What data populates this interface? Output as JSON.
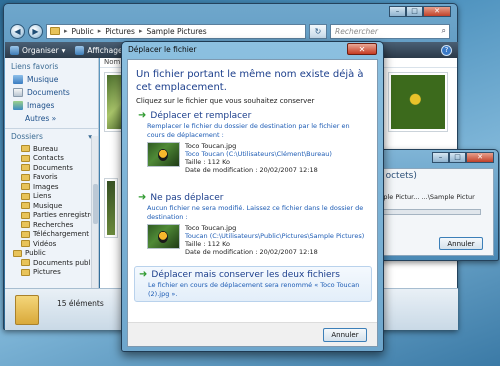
{
  "explorer": {
    "address": [
      "Public",
      "Pictures",
      "Sample Pictures"
    ],
    "search_placeholder": "Rechercher",
    "toolbar": {
      "organize": "Organiser",
      "views": "Affichages"
    },
    "help": "?",
    "nav": {
      "favorites_heading": "Liens favoris",
      "favorites": [
        "Musique",
        "Documents",
        "Images"
      ],
      "more": "Autres »",
      "folders_heading": "Dossiers",
      "folders": [
        "Bureau",
        "Contacts",
        "Documents",
        "Favoris",
        "Images",
        "Liens",
        "Musique",
        "Parties enregistrée",
        "Recherches",
        "Téléchargement",
        "Vidéos",
        "Public",
        "Documents public",
        "Pictures"
      ]
    },
    "column_header": "Nom",
    "status": "15 éléments"
  },
  "progress_window": {
    "title_fragment": "0 octets)",
    "path_fragment": "mple Pictur... ...\\Sample Pictur",
    "progress_fraction": 0.0,
    "cancel": "Annuler"
  },
  "dialog": {
    "title": "Déplacer le fichier",
    "close_glyph": "✕",
    "heading": "Un fichier portant le même nom existe déjà à cet emplacement.",
    "subheading": "Cliquez sur le fichier que vous souhaitez conserver",
    "options": [
      {
        "title": "Déplacer et remplacer",
        "description": "Remplacer le fichier du dossier de destination par le fichier en cours de déplacement :",
        "file_name": "Toco Toucan.jpg",
        "file_path": "Toco Toucan (C:\\Utilisateurs\\Clément\\Bureau)",
        "size": "Taille : 112 Ko",
        "modified": "Date de modification : 20/02/2007 12:18"
      },
      {
        "title": "Ne pas déplacer",
        "description": "Aucun fichier ne sera modifié. Laissez ce fichier dans le dossier de destination :",
        "file_name": "Toco Toucan.jpg",
        "file_path": "Toucan (C:\\Utilisateurs\\Public\\Pictures\\Sample Pictures)",
        "size": "Taille : 112 Ko",
        "modified": "Date de modification : 20/02/2007 12:18"
      },
      {
        "title": "Déplacer mais conserver les deux fichiers",
        "description": "Le fichier en cours de déplacement sera renommé « Toco Toucan (2).jpg »."
      }
    ],
    "cancel": "Annuler"
  },
  "colors": {
    "heading_blue": "#1c3f8c",
    "link_blue": "#1c5bb4",
    "arrow_green": "#2f9a2f"
  }
}
